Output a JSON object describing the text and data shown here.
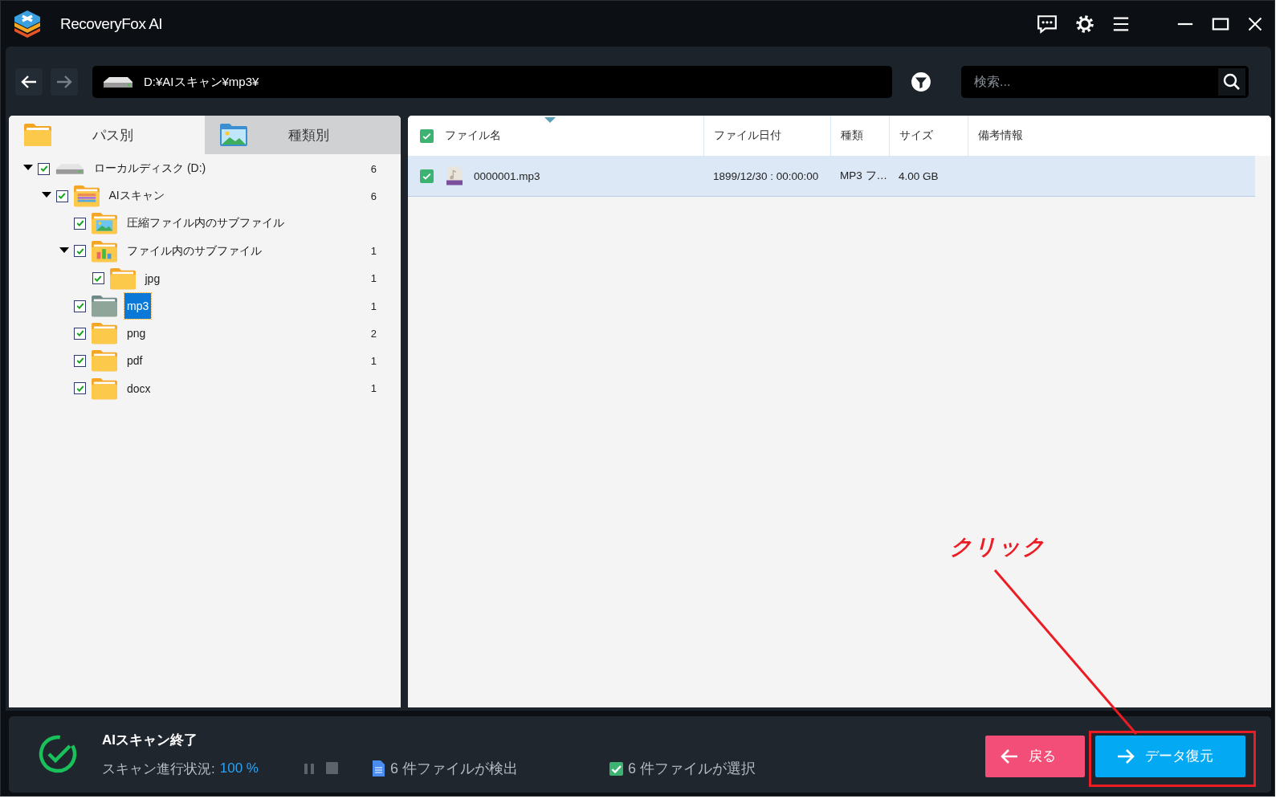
{
  "window": {
    "title": "RecoveryFox AI"
  },
  "toolbar": {
    "path": "D:¥AIスキャン¥mp3¥",
    "search": {
      "placeholder": "検索..."
    }
  },
  "tabs": [
    {
      "label": "パス別",
      "selected": true,
      "kind": "folder"
    },
    {
      "label": "種類別",
      "selected": false,
      "kind": "image"
    }
  ],
  "tree": [
    {
      "label": "ローカルディスク (D:)",
      "count": "6",
      "kind": "drive",
      "checked": true,
      "selected": false,
      "expanded": true,
      "children": [
        {
          "label": "AIスキャン",
          "count": "6",
          "kind": "scan",
          "checked": true,
          "selected": false,
          "expanded": true,
          "children": [
            {
              "label": "圧縮ファイル内のサブファイル",
              "kind": "image",
              "checked": true,
              "selected": false
            },
            {
              "label": "ファイル内のサブファイル",
              "count": "1",
              "kind": "chart",
              "checked": true,
              "selected": false,
              "expanded": true,
              "children": [
                {
                  "label": "jpg",
                  "count": "1",
                  "kind": "folder",
                  "checked": true,
                  "selected": false
                }
              ]
            },
            {
              "label": "mp3",
              "count": "1",
              "kind": "folder",
              "checked": true,
              "selected": true
            },
            {
              "label": "png",
              "count": "2",
              "kind": "folder",
              "checked": true,
              "selected": false
            },
            {
              "label": "pdf",
              "count": "1",
              "kind": "folder",
              "checked": true,
              "selected": false
            },
            {
              "label": "docx",
              "count": "1",
              "kind": "folder",
              "checked": true,
              "selected": false
            }
          ]
        }
      ]
    }
  ],
  "file_table": {
    "all_checked": true,
    "columns": [
      "ファイル名",
      "ファイル日付",
      "種類",
      "サイズ",
      "備考情報"
    ],
    "rows": [
      {
        "checked": true,
        "selected": true,
        "cells": [
          "0000001.mp3",
          "1899/12/30 : 00:00:00",
          "MP3 フ…",
          "4.00 GB"
        ]
      }
    ]
  },
  "status": {
    "title": "AIスキャン終了",
    "progress_label": "スキャン進行状況:",
    "progress_value": "100 %",
    "found": "6 件ファイルが検出",
    "selected_count": "6 件ファイルが選択"
  },
  "buttons": [
    {
      "label": "戻る",
      "kind": "back"
    },
    {
      "label": "データ復元",
      "kind": "recover"
    }
  ],
  "annotation": {
    "text": "クリック"
  }
}
